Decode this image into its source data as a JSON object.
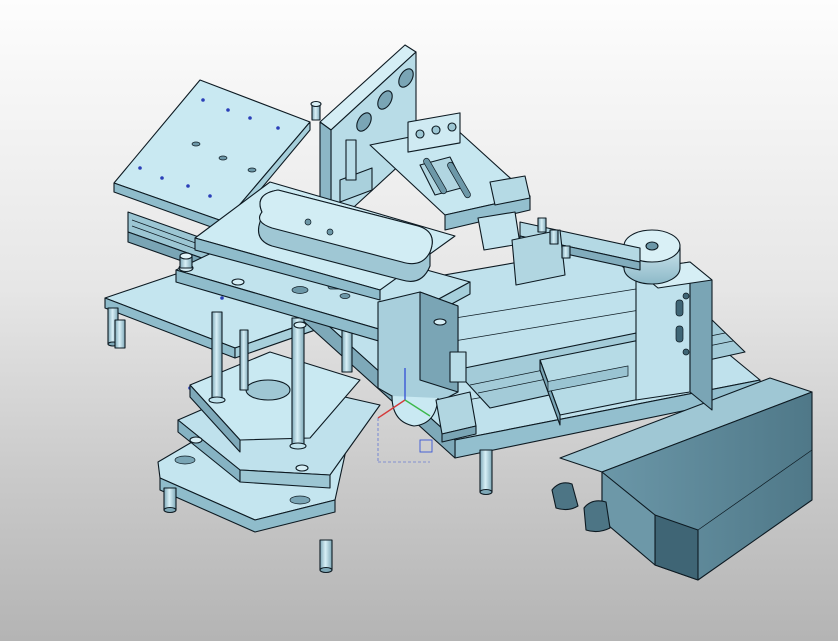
{
  "viewport": {
    "background_top": "#fdfdfd",
    "background_bottom": "#b4b4b4"
  },
  "model": {
    "shade_light": "#c9e9f2",
    "shade_mid": "#a8cfdc",
    "shade_dark": "#86b3c3",
    "shade_deep": "#5d8696",
    "edge_color": "#0d1a22",
    "hole_marker_color": "#2a3fb8"
  },
  "triad": {
    "x_color": "#d43b3b",
    "y_color": "#3cb84b",
    "z_color": "#3a57d6"
  }
}
